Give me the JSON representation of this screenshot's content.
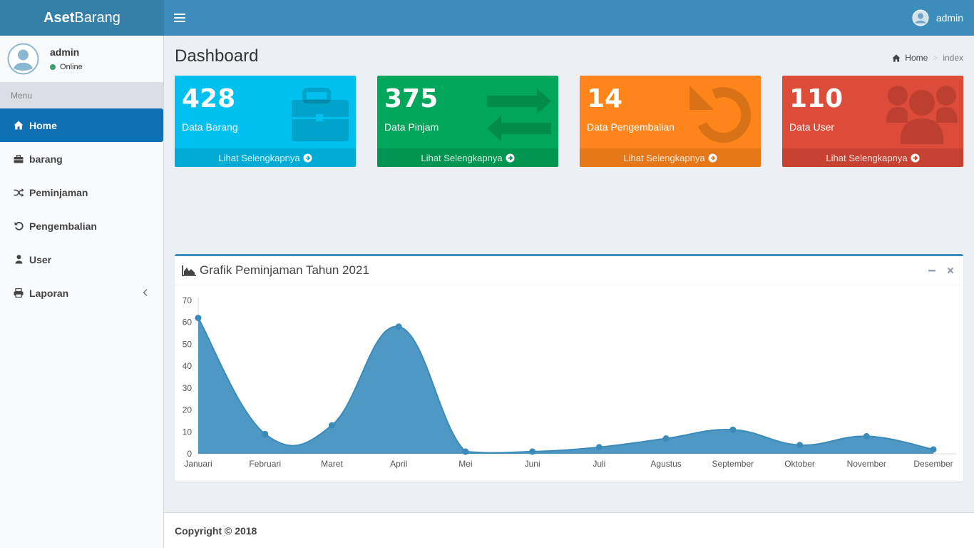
{
  "app": {
    "logo_bold": "Aset",
    "logo_rest": "Barang"
  },
  "topbar": {
    "user_name": "admin"
  },
  "sidebar": {
    "user_name": "admin",
    "status": "Online",
    "menu_header": "Menu",
    "items": [
      {
        "label": "Home",
        "icon": "home-icon"
      },
      {
        "label": "barang",
        "icon": "briefcase-icon"
      },
      {
        "label": "Peminjaman",
        "icon": "shuffle-icon"
      },
      {
        "label": "Pengembalian",
        "icon": "undo-icon"
      },
      {
        "label": "User",
        "icon": "user-icon"
      },
      {
        "label": "Laporan",
        "icon": "print-icon"
      }
    ]
  },
  "page": {
    "title": "Dashboard",
    "breadcrumb_home": "Home",
    "breadcrumb_current": "index"
  },
  "boxes": [
    {
      "value": "428",
      "label": "Data Barang",
      "link": "Lihat Selengkapnya",
      "color": "#00c0ef",
      "icon": "briefcase-icon"
    },
    {
      "value": "375",
      "label": "Data Pinjam",
      "link": "Lihat Selengkapnya",
      "color": "#00a65a",
      "icon": "exchange-icon"
    },
    {
      "value": "14",
      "label": "Data Pengembalian",
      "link": "Lihat Selengkapnya",
      "color": "#ff851b",
      "icon": "undo-icon"
    },
    {
      "value": "110",
      "label": "Data User",
      "link": "Lihat Selengkapnya",
      "color": "#dd4b39",
      "icon": "users-icon"
    }
  ],
  "chart_box": {
    "title": "Grafik Peminjaman Tahun 2021"
  },
  "chart_data": {
    "type": "area",
    "categories": [
      "Januari",
      "Februari",
      "Maret",
      "April",
      "Mei",
      "Juni",
      "Juli",
      "Agustus",
      "September",
      "Oktober",
      "November",
      "Desember"
    ],
    "series": [
      {
        "values": [
          62,
          9,
          13,
          58,
          1,
          1,
          3,
          7,
          11,
          4,
          8,
          2
        ]
      }
    ],
    "ylim": [
      0,
      70
    ],
    "yticks": [
      0,
      10,
      20,
      30,
      40,
      50,
      60,
      70
    ],
    "color": "#3c8dbc"
  },
  "footer": {
    "text": "Copyright © 2018"
  }
}
